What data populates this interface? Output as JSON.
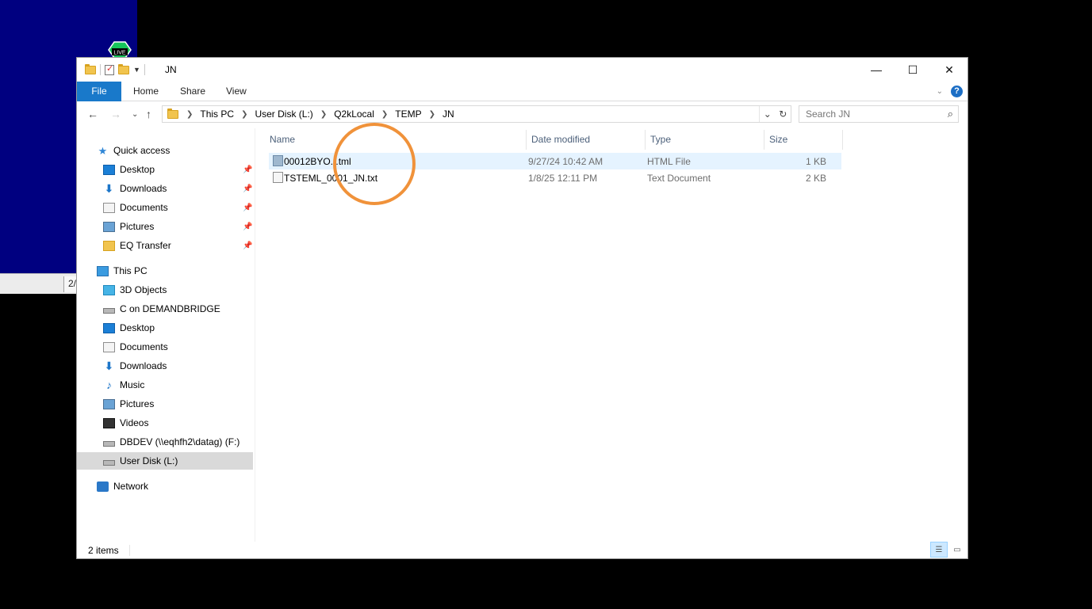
{
  "background": {
    "live_badge": "LIVE",
    "strip_text": "2/"
  },
  "window": {
    "title": "JN"
  },
  "ribbon": {
    "tabs": [
      "File",
      "Home",
      "Share",
      "View"
    ]
  },
  "nav": {
    "breadcrumb": [
      "This PC",
      "User Disk (L:)",
      "Q2kLocal",
      "TEMP",
      "JN"
    ]
  },
  "search": {
    "placeholder": "Search JN"
  },
  "sidebar": {
    "quick_access": "Quick access",
    "quick_items": [
      "Desktop",
      "Downloads",
      "Documents",
      "Pictures",
      "EQ Transfer"
    ],
    "this_pc": "This PC",
    "pc_items": [
      "3D Objects",
      "C on DEMANDBRIDGE",
      "Desktop",
      "Documents",
      "Downloads",
      "Music",
      "Pictures",
      "Videos",
      "DBDEV (\\\\eqhfh2\\datag) (F:)",
      "User Disk (L:)"
    ],
    "network": "Network"
  },
  "columns": [
    "Name",
    "Date modified",
    "Type",
    "Size"
  ],
  "files": [
    {
      "name": "00012BYO...tml",
      "date": "9/27/24 10:42 AM",
      "type": "HTML File",
      "size": "1 KB"
    },
    {
      "name": "TSTEML_0001_JN.txt",
      "date": "1/8/25 12:11 PM",
      "type": "Text Document",
      "size": "2 KB"
    }
  ],
  "status": {
    "item_count": "2 items"
  },
  "colors": {
    "accent": "#1979ca",
    "highlight": "#e5f3ff",
    "annotation_ring": "#f0923a",
    "desktop": "#000080"
  }
}
